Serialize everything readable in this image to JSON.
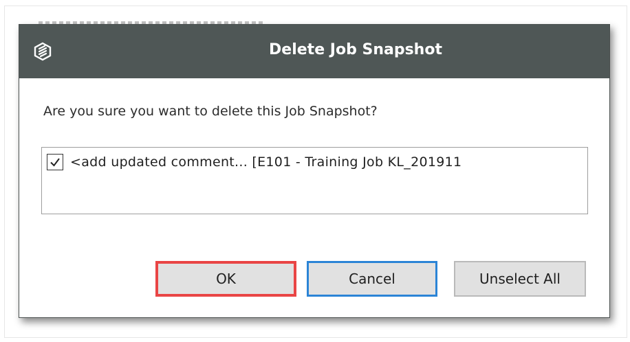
{
  "dialog": {
    "title": "Delete Job Snapshot",
    "icon": "app-logo-icon",
    "prompt": "Are you sure you want to delete this Job Snapshot?",
    "items": [
      {
        "checked": true,
        "label": "<add updated comment... [E101 - Training Job KL_201911"
      }
    ],
    "buttons": {
      "ok": "OK",
      "cancel": "Cancel",
      "unselect_all": "Unselect All"
    }
  },
  "colors": {
    "titlebar": "#4f5756",
    "ok_highlight": "#e94545",
    "cancel_focus": "#2b84d6",
    "button_face": "#e1e1e1"
  }
}
